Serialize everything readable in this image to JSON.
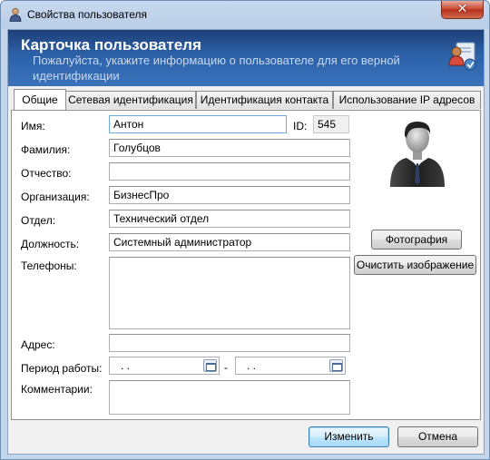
{
  "window": {
    "title": "Свойства пользователя",
    "close_glyph": "✕"
  },
  "header": {
    "title": "Карточка пользователя",
    "subtitle": "Пожалуйста, укажите информацию о пользователе для его верной идентификации",
    "icon": "user-card-icon"
  },
  "tabs": [
    {
      "label": "Общие",
      "active": true
    },
    {
      "label": "Сетевая идентификация",
      "active": false
    },
    {
      "label": "Идентификация контакта",
      "active": false
    },
    {
      "label": "Использование IP адресов",
      "active": false
    }
  ],
  "form": {
    "first_name": {
      "label": "Имя:",
      "value": "Антон"
    },
    "id": {
      "label": "ID:",
      "value": "545"
    },
    "last_name": {
      "label": "Фамилия:",
      "value": "Голубцов"
    },
    "middle_name": {
      "label": "Отчество:",
      "value": ""
    },
    "organization": {
      "label": "Организация:",
      "value": "БизнесПро"
    },
    "department": {
      "label": "Отдел:",
      "value": "Технический отдел"
    },
    "position": {
      "label": "Должность:",
      "value": "Системный администратор"
    },
    "phones": {
      "label": "Телефоны:",
      "value": ""
    },
    "address": {
      "label": "Адрес:",
      "value": ""
    },
    "work_period": {
      "label": "Период работы:",
      "start": " .   . ",
      "separator": "-",
      "end": " .   . "
    },
    "comments": {
      "label": "Комментарии:",
      "value": ""
    }
  },
  "photo": {
    "photo_button": "Фотография",
    "clear_button": "Очистить изображение",
    "avatar_icon": "user-avatar-icon"
  },
  "footer": {
    "ok_button": "Изменить",
    "cancel_button": "Отмена"
  },
  "colors": {
    "header_bg": "#2c5fa5",
    "title_close": "#c8442b"
  }
}
